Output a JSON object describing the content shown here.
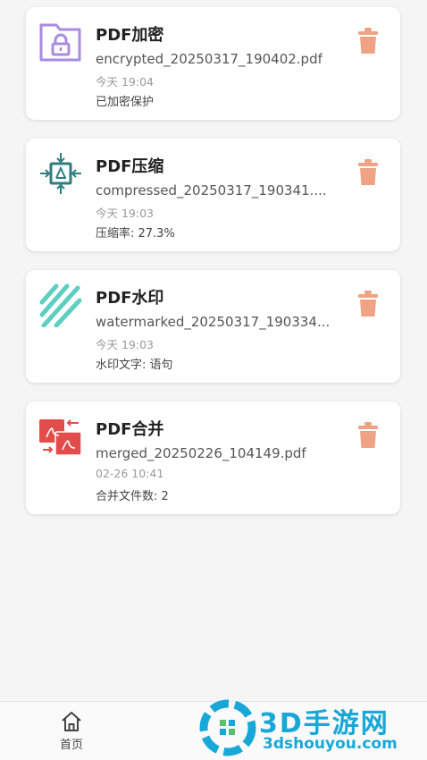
{
  "records": [
    {
      "title": "PDF加密",
      "filename": "encrypted_20250317_190402.pdf",
      "time": "今天 19:04",
      "detail": "已加密保护",
      "icon": "lock-folder-icon"
    },
    {
      "title": "PDF压缩",
      "filename": "compressed_20250317_190341....",
      "time": "今天 19:03",
      "detail": "压缩率: 27.3%",
      "icon": "compress-icon"
    },
    {
      "title": "PDF水印",
      "filename": "watermarked_20250317_190334...",
      "time": "今天 19:03",
      "detail": "水印文字: 语句",
      "icon": "watermark-stripes-icon"
    },
    {
      "title": "PDF合并",
      "filename": "merged_20250226_104149.pdf",
      "time": "02-26 10:41",
      "detail": "合并文件数: 2",
      "icon": "merge-pdf-icon"
    }
  ],
  "bottom_nav": {
    "home_label": "首页"
  },
  "watermark": {
    "brand": "3D手游网",
    "url": "3dshouyou.com"
  },
  "colors": {
    "purple": "#a98be0",
    "teal_dark": "#2f7d7f",
    "teal_light": "#5ccfc0",
    "red": "#e24c4b",
    "delete": "#f0a384",
    "watermark": "#17a8d8"
  }
}
